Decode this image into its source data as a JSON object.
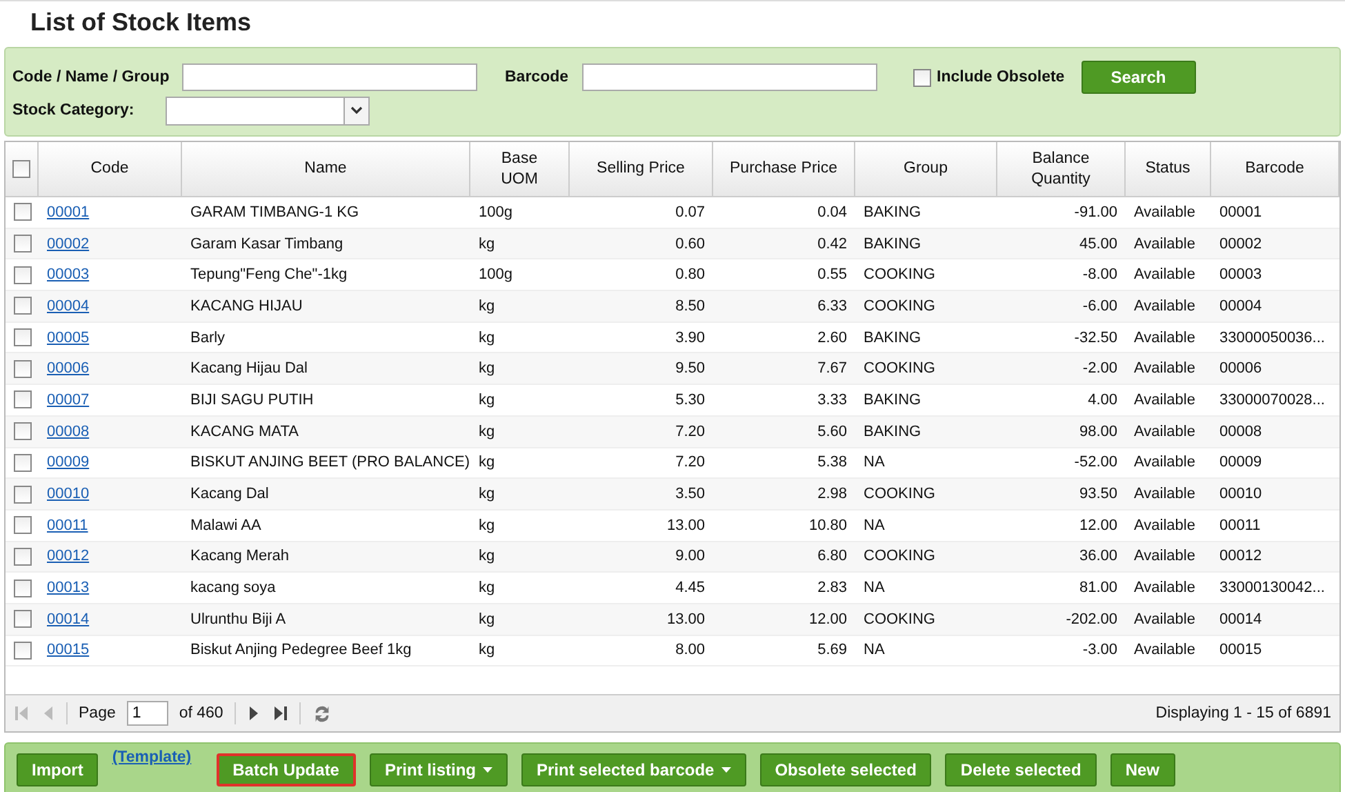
{
  "title": "List of Stock Items",
  "filters": {
    "code_label": "Code / Name / Group",
    "barcode_label": "Barcode",
    "include_obsolete": {
      "label": "Include Obsolete",
      "checked": false
    },
    "search_button": "Search",
    "category_label": "Stock Category:"
  },
  "table": {
    "select_all_checked": false,
    "columns": [
      "Code",
      "Name",
      "Base UOM",
      "Selling Price",
      "Purchase Price",
      "Group",
      "Balance Quantity",
      "Status",
      "Barcode"
    ],
    "rows": [
      {
        "checked": false,
        "cells": [
          "00001",
          "GARAM TIMBANG-1 KG",
          "100g",
          "0.07",
          "0.04",
          "BAKING",
          "-91.00",
          "Available",
          "00001"
        ]
      },
      {
        "checked": false,
        "cells": [
          "00002",
          "Garam Kasar Timbang",
          "kg",
          "0.60",
          "0.42",
          "BAKING",
          "45.00",
          "Available",
          "00002"
        ]
      },
      {
        "checked": false,
        "cells": [
          "00003",
          "Tepung\"Feng Che\"-1kg",
          "100g",
          "0.80",
          "0.55",
          "COOKING",
          "-8.00",
          "Available",
          "00003"
        ]
      },
      {
        "checked": false,
        "cells": [
          "00004",
          "KACANG HIJAU",
          "kg",
          "8.50",
          "6.33",
          "COOKING",
          "-6.00",
          "Available",
          "00004"
        ]
      },
      {
        "checked": false,
        "cells": [
          "00005",
          "Barly",
          "kg",
          "3.90",
          "2.60",
          "BAKING",
          "-32.50",
          "Available",
          "33000050036..."
        ]
      },
      {
        "checked": false,
        "cells": [
          "00006",
          "Kacang Hijau Dal",
          "kg",
          "9.50",
          "7.67",
          "COOKING",
          "-2.00",
          "Available",
          "00006"
        ]
      },
      {
        "checked": false,
        "cells": [
          "00007",
          "BIJI SAGU PUTIH",
          "kg",
          "5.30",
          "3.33",
          "BAKING",
          "4.00",
          "Available",
          "33000070028..."
        ]
      },
      {
        "checked": false,
        "cells": [
          "00008",
          "KACANG MATA",
          "kg",
          "7.20",
          "5.60",
          "BAKING",
          "98.00",
          "Available",
          "00008"
        ]
      },
      {
        "checked": false,
        "cells": [
          "00009",
          "BISKUT ANJING BEET (PRO BALANCE)",
          "kg",
          "7.20",
          "5.38",
          "NA",
          "-52.00",
          "Available",
          "00009"
        ]
      },
      {
        "checked": false,
        "cells": [
          "00010",
          "Kacang Dal",
          "kg",
          "3.50",
          "2.98",
          "COOKING",
          "93.50",
          "Available",
          "00010"
        ]
      },
      {
        "checked": false,
        "cells": [
          "00011",
          "Malawi AA",
          "kg",
          "13.00",
          "10.80",
          "NA",
          "12.00",
          "Available",
          "00011"
        ]
      },
      {
        "checked": false,
        "cells": [
          "00012",
          "Kacang Merah",
          "kg",
          "9.00",
          "6.80",
          "COOKING",
          "36.00",
          "Available",
          "00012"
        ]
      },
      {
        "checked": false,
        "cells": [
          "00013",
          "kacang soya",
          "kg",
          "4.45",
          "2.83",
          "NA",
          "81.00",
          "Available",
          "33000130042..."
        ]
      },
      {
        "checked": false,
        "cells": [
          "00014",
          "Ulrunthu Biji A",
          "kg",
          "13.00",
          "12.00",
          "COOKING",
          "-202.00",
          "Available",
          "00014"
        ]
      },
      {
        "checked": false,
        "cells": [
          "00015",
          "Biskut Anjing Pedegree Beef 1kg",
          "kg",
          "8.00",
          "5.69",
          "NA",
          "-3.00",
          "Available",
          "00015"
        ]
      }
    ]
  },
  "pager": {
    "page_label": "Page",
    "page": "1",
    "of_label": "of 460",
    "summary": "Displaying 1 - 15 of 6891"
  },
  "actions": [
    {
      "kind": "button",
      "label": "Import",
      "focused": false
    },
    {
      "kind": "link",
      "label": "(Template)",
      "focused": false
    },
    {
      "kind": "button",
      "label": "Batch Update",
      "focused": true
    },
    {
      "kind": "dropdown",
      "label": "Print listing",
      "focused": false
    },
    {
      "kind": "dropdown",
      "label": "Print selected barcode",
      "focused": false
    },
    {
      "kind": "button",
      "label": "Obsolete selected",
      "focused": false
    },
    {
      "kind": "button",
      "label": "Delete selected",
      "focused": false
    },
    {
      "kind": "button",
      "label": "New",
      "focused": false
    }
  ]
}
